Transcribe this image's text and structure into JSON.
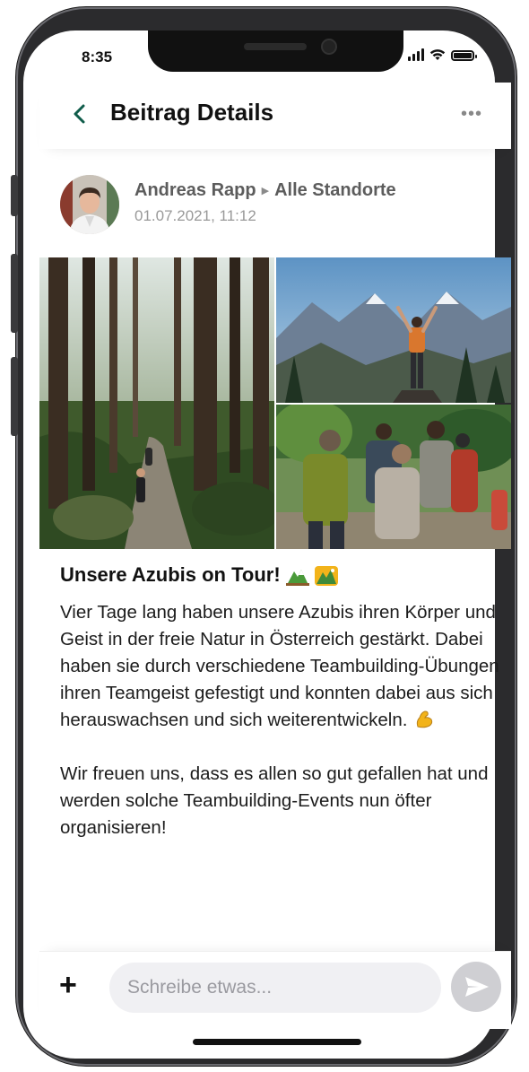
{
  "status_bar": {
    "time": "8:35"
  },
  "header": {
    "title": "Beitrag Details",
    "more": "•••"
  },
  "post": {
    "author": "Andreas Rapp",
    "separator": "▶",
    "audience": "Alle Standorte",
    "date": "01.07.2021, 11:12",
    "title": "Unsere Azubis on Tour!",
    "paragraph_1": "Vier Tage lang haben unsere Azubis ihren Körper und Geist in der freie Natur in Österreich gestärkt. Dabei haben sie durch verschiedene Teambuilding-Übungen ihren Teamgeist gefestigt und konnten dabei aus sich herauswachsen und sich weiterentwickeln.",
    "paragraph_2": "Wir freuen uns, dass es allen so gut gefallen hat und werden solche Teambuilding-Events nun öfter organisieren!",
    "images": [
      "forest-hiking-photo",
      "mountain-summit-photo",
      "hiking-group-photo"
    ]
  },
  "composer": {
    "plus": "+",
    "placeholder": "Schreibe etwas..."
  },
  "colors": {
    "accent": "#0f5c4a",
    "send_button": "#cfcfd3"
  },
  "icons": [
    "back-chevron-icon",
    "more-dots-icon",
    "mountain-emoji-icon",
    "national-park-emoji-icon",
    "flexed-biceps-emoji-icon",
    "plus-icon",
    "send-icon"
  ]
}
